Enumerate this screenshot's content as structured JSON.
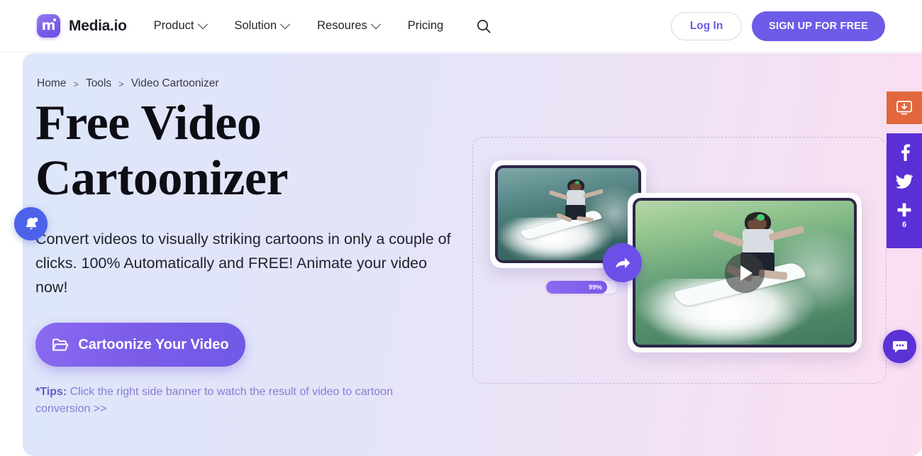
{
  "header": {
    "logo_text": "Media.io",
    "nav_items": [
      {
        "label": "Product",
        "has_dropdown": true
      },
      {
        "label": "Solution",
        "has_dropdown": true
      },
      {
        "label": "Resoures",
        "has_dropdown": true
      },
      {
        "label": "Pricing",
        "has_dropdown": false
      }
    ],
    "search_icon": "search-icon",
    "login_label": "Log In",
    "signup_label": "SIGN UP FOR FREE"
  },
  "breadcrumb": {
    "items": [
      "Home",
      "Tools",
      "Video Cartoonizer"
    ],
    "separator": ">"
  },
  "hero": {
    "title_line1": "Free Video",
    "title_line2": "Cartoonizer",
    "subtitle": "Convert videos to visually striking cartoons in only a couple of clicks. 100% Automatically and FREE! Animate your video now!",
    "cta_label": "Cartoonize Your Video",
    "cta_icon": "folder-open-icon",
    "tips_label": "*Tips:",
    "tips_text": " Click the right side banner to watch the result of video to cartoon conversion >>"
  },
  "visual": {
    "source_card_name": "original-video-card",
    "result_card_name": "cartoonized-video-card",
    "arrow_icon": "share-arrow-icon",
    "play_icon": "play-icon",
    "progress_value": "99%",
    "progress_percent": 86
  },
  "floating": {
    "bell_icon": "bell-notification-icon"
  },
  "rail": {
    "download_icon": "monitor-download-icon",
    "social": [
      {
        "icon": "facebook-icon",
        "label": ""
      },
      {
        "icon": "twitter-icon",
        "label": ""
      },
      {
        "icon": "plus-share-icon",
        "label": "6"
      }
    ],
    "chat_icon": "chat-bubble-icon"
  },
  "colors": {
    "brand_purple": "#6c5ce7",
    "rail_purple": "#5b2fd6",
    "rail_orange": "#e2683c",
    "bell_blue": "#4a63e8",
    "tips_purple": "#8a7bd4"
  }
}
